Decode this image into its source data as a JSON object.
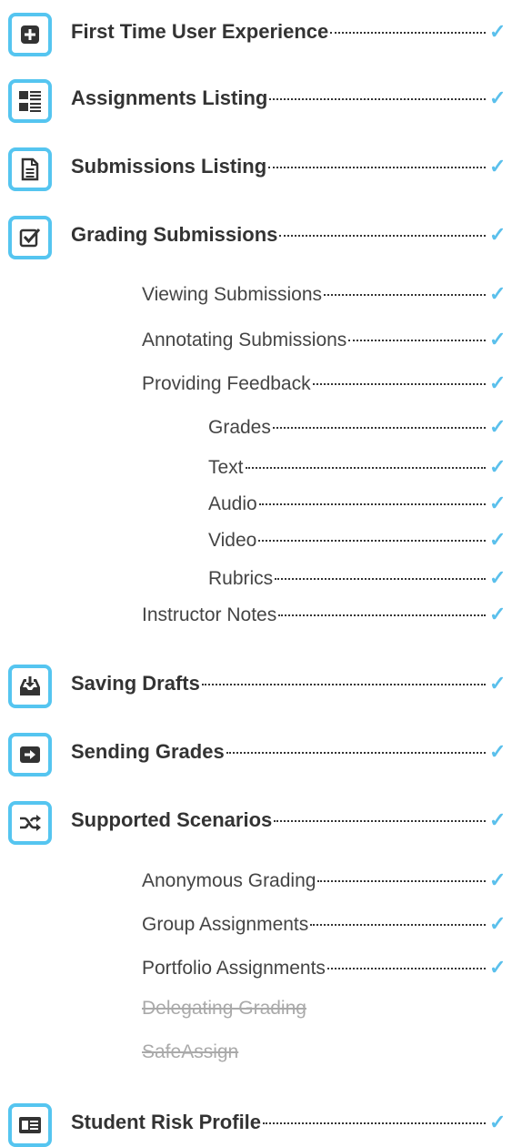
{
  "accent_color": "#55c5f0",
  "items": [
    {
      "label": "First Time User Experience",
      "level": 0,
      "icon": "plus-square-icon",
      "checked": true
    },
    {
      "label": "Assignments Listing",
      "level": 0,
      "icon": "list-icon",
      "checked": true
    },
    {
      "label": "Submissions Listing",
      "level": 0,
      "icon": "document-icon",
      "checked": true
    },
    {
      "label": "Grading Submissions",
      "level": 0,
      "icon": "checkbox-icon",
      "checked": true
    },
    {
      "label": "Viewing Submissions",
      "level": 1,
      "checked": true
    },
    {
      "label": "Annotating Submissions",
      "level": 1,
      "checked": true
    },
    {
      "label": "Providing Feedback",
      "level": 1,
      "checked": true
    },
    {
      "label": "Grades",
      "level": 2,
      "checked": true
    },
    {
      "label": "Text",
      "level": 2,
      "checked": true
    },
    {
      "label": "Audio",
      "level": 2,
      "checked": true
    },
    {
      "label": "Video",
      "level": 2,
      "checked": true
    },
    {
      "label": "Rubrics",
      "level": 2,
      "checked": true
    },
    {
      "label": "Instructor Notes",
      "level": 1,
      "checked": true
    },
    {
      "label": "Saving Drafts",
      "level": 0,
      "icon": "inbox-download-icon",
      "checked": true
    },
    {
      "label": "Sending Grades",
      "level": 0,
      "icon": "arrow-right-icon",
      "checked": true
    },
    {
      "label": "Supported Scenarios",
      "level": 0,
      "icon": "shuffle-icon",
      "checked": true
    },
    {
      "label": "Anonymous Grading",
      "level": 1,
      "checked": true
    },
    {
      "label": "Group Assignments",
      "level": 1,
      "checked": true
    },
    {
      "label": "Portfolio Assignments",
      "level": 1,
      "checked": true
    },
    {
      "label": "Delegating Grading",
      "level": 1,
      "checked": false,
      "struck": true
    },
    {
      "label": "SafeAssign",
      "level": 1,
      "checked": false,
      "struck": true
    },
    {
      "label": "Student Risk Profile",
      "level": 0,
      "icon": "id-card-icon",
      "checked": true
    }
  ],
  "check_glyph": "✓"
}
